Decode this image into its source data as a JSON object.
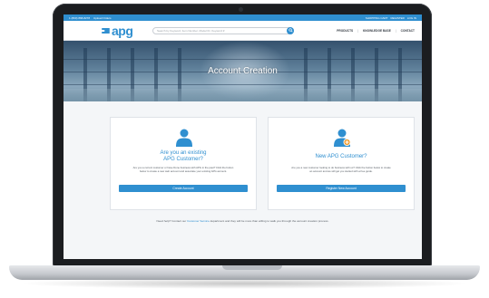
{
  "topbar": {
    "phone": "1 (800) 868-8278",
    "left_link": "Upload Orders",
    "right_links": [
      "SHOPPING CART",
      "REGISTER",
      "LOG IN"
    ]
  },
  "header": {
    "logo_text": "apg",
    "search_placeholder": "Search by Keyword, Item Number, Model ID, Keyword #",
    "nav": [
      "PRODUCTS",
      "KNOWLEDGE BASE",
      "CONTACT"
    ]
  },
  "hero": {
    "title": "Account Creation"
  },
  "cards": [
    {
      "title_line1": "Are you an existing",
      "title_line2": "APG Customer?",
      "body": "Are you a current customer or have Done business with APG in the past? Click the button below to create a new web account and associate your existing APG account.",
      "button": "Create Account"
    },
    {
      "title_line1": "New APG Customer?",
      "title_line2": "",
      "body": "Are you a new customer looking to do business with us? Click the button below to create an account and we will get you started with a free guide.",
      "button": "Register New Account"
    }
  ],
  "footer": {
    "before": "Need help? Contact our",
    "link": "Customer Service",
    "after": "department and they will be more than willing to walk you through the account creation process."
  },
  "colors": {
    "brand": "#2f8fd0",
    "accent_badge": "#f0a23b"
  }
}
